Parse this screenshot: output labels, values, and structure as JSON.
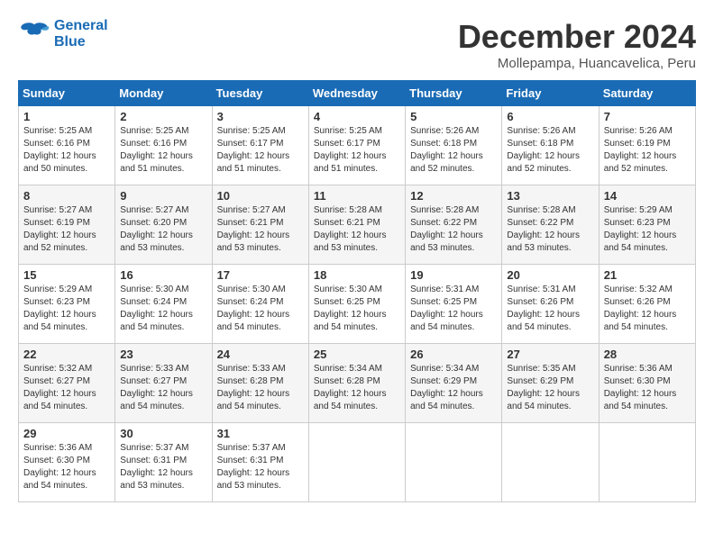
{
  "header": {
    "logo_line1": "General",
    "logo_line2": "Blue",
    "month": "December 2024",
    "location": "Mollepampa, Huancavelica, Peru"
  },
  "days_of_week": [
    "Sunday",
    "Monday",
    "Tuesday",
    "Wednesday",
    "Thursday",
    "Friday",
    "Saturday"
  ],
  "weeks": [
    [
      {
        "day": "1",
        "info": "Sunrise: 5:25 AM\nSunset: 6:16 PM\nDaylight: 12 hours\nand 50 minutes."
      },
      {
        "day": "2",
        "info": "Sunrise: 5:25 AM\nSunset: 6:16 PM\nDaylight: 12 hours\nand 51 minutes."
      },
      {
        "day": "3",
        "info": "Sunrise: 5:25 AM\nSunset: 6:17 PM\nDaylight: 12 hours\nand 51 minutes."
      },
      {
        "day": "4",
        "info": "Sunrise: 5:25 AM\nSunset: 6:17 PM\nDaylight: 12 hours\nand 51 minutes."
      },
      {
        "day": "5",
        "info": "Sunrise: 5:26 AM\nSunset: 6:18 PM\nDaylight: 12 hours\nand 52 minutes."
      },
      {
        "day": "6",
        "info": "Sunrise: 5:26 AM\nSunset: 6:18 PM\nDaylight: 12 hours\nand 52 minutes."
      },
      {
        "day": "7",
        "info": "Sunrise: 5:26 AM\nSunset: 6:19 PM\nDaylight: 12 hours\nand 52 minutes."
      }
    ],
    [
      {
        "day": "8",
        "info": "Sunrise: 5:27 AM\nSunset: 6:19 PM\nDaylight: 12 hours\nand 52 minutes."
      },
      {
        "day": "9",
        "info": "Sunrise: 5:27 AM\nSunset: 6:20 PM\nDaylight: 12 hours\nand 53 minutes."
      },
      {
        "day": "10",
        "info": "Sunrise: 5:27 AM\nSunset: 6:21 PM\nDaylight: 12 hours\nand 53 minutes."
      },
      {
        "day": "11",
        "info": "Sunrise: 5:28 AM\nSunset: 6:21 PM\nDaylight: 12 hours\nand 53 minutes."
      },
      {
        "day": "12",
        "info": "Sunrise: 5:28 AM\nSunset: 6:22 PM\nDaylight: 12 hours\nand 53 minutes."
      },
      {
        "day": "13",
        "info": "Sunrise: 5:28 AM\nSunset: 6:22 PM\nDaylight: 12 hours\nand 53 minutes."
      },
      {
        "day": "14",
        "info": "Sunrise: 5:29 AM\nSunset: 6:23 PM\nDaylight: 12 hours\nand 54 minutes."
      }
    ],
    [
      {
        "day": "15",
        "info": "Sunrise: 5:29 AM\nSunset: 6:23 PM\nDaylight: 12 hours\nand 54 minutes."
      },
      {
        "day": "16",
        "info": "Sunrise: 5:30 AM\nSunset: 6:24 PM\nDaylight: 12 hours\nand 54 minutes."
      },
      {
        "day": "17",
        "info": "Sunrise: 5:30 AM\nSunset: 6:24 PM\nDaylight: 12 hours\nand 54 minutes."
      },
      {
        "day": "18",
        "info": "Sunrise: 5:30 AM\nSunset: 6:25 PM\nDaylight: 12 hours\nand 54 minutes."
      },
      {
        "day": "19",
        "info": "Sunrise: 5:31 AM\nSunset: 6:25 PM\nDaylight: 12 hours\nand 54 minutes."
      },
      {
        "day": "20",
        "info": "Sunrise: 5:31 AM\nSunset: 6:26 PM\nDaylight: 12 hours\nand 54 minutes."
      },
      {
        "day": "21",
        "info": "Sunrise: 5:32 AM\nSunset: 6:26 PM\nDaylight: 12 hours\nand 54 minutes."
      }
    ],
    [
      {
        "day": "22",
        "info": "Sunrise: 5:32 AM\nSunset: 6:27 PM\nDaylight: 12 hours\nand 54 minutes."
      },
      {
        "day": "23",
        "info": "Sunrise: 5:33 AM\nSunset: 6:27 PM\nDaylight: 12 hours\nand 54 minutes."
      },
      {
        "day": "24",
        "info": "Sunrise: 5:33 AM\nSunset: 6:28 PM\nDaylight: 12 hours\nand 54 minutes."
      },
      {
        "day": "25",
        "info": "Sunrise: 5:34 AM\nSunset: 6:28 PM\nDaylight: 12 hours\nand 54 minutes."
      },
      {
        "day": "26",
        "info": "Sunrise: 5:34 AM\nSunset: 6:29 PM\nDaylight: 12 hours\nand 54 minutes."
      },
      {
        "day": "27",
        "info": "Sunrise: 5:35 AM\nSunset: 6:29 PM\nDaylight: 12 hours\nand 54 minutes."
      },
      {
        "day": "28",
        "info": "Sunrise: 5:36 AM\nSunset: 6:30 PM\nDaylight: 12 hours\nand 54 minutes."
      }
    ],
    [
      {
        "day": "29",
        "info": "Sunrise: 5:36 AM\nSunset: 6:30 PM\nDaylight: 12 hours\nand 54 minutes."
      },
      {
        "day": "30",
        "info": "Sunrise: 5:37 AM\nSunset: 6:31 PM\nDaylight: 12 hours\nand 53 minutes."
      },
      {
        "day": "31",
        "info": "Sunrise: 5:37 AM\nSunset: 6:31 PM\nDaylight: 12 hours\nand 53 minutes."
      },
      null,
      null,
      null,
      null
    ]
  ]
}
